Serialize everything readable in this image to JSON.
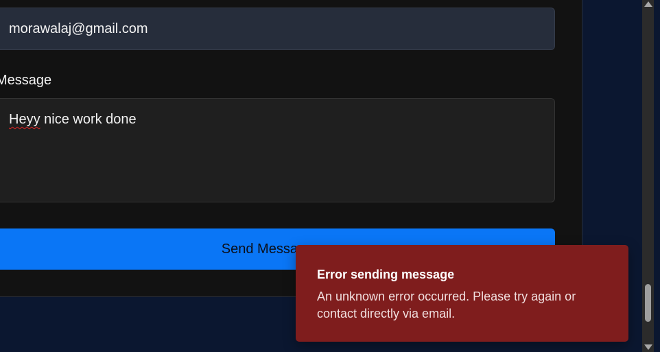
{
  "form": {
    "email_value": "morawalaj@gmail.com",
    "message_label": "Message",
    "message_value_misspelled": "Heyy",
    "message_value_rest": " nice work done",
    "send_label": "Send Message"
  },
  "toast": {
    "title": "Error sending message",
    "body": "An unknown error occurred. Please try again or contact directly via email."
  },
  "colors": {
    "page_bg": "#0b1730",
    "card_bg": "#121212",
    "accent": "#0a76f6",
    "error": "#7f1d1d"
  }
}
